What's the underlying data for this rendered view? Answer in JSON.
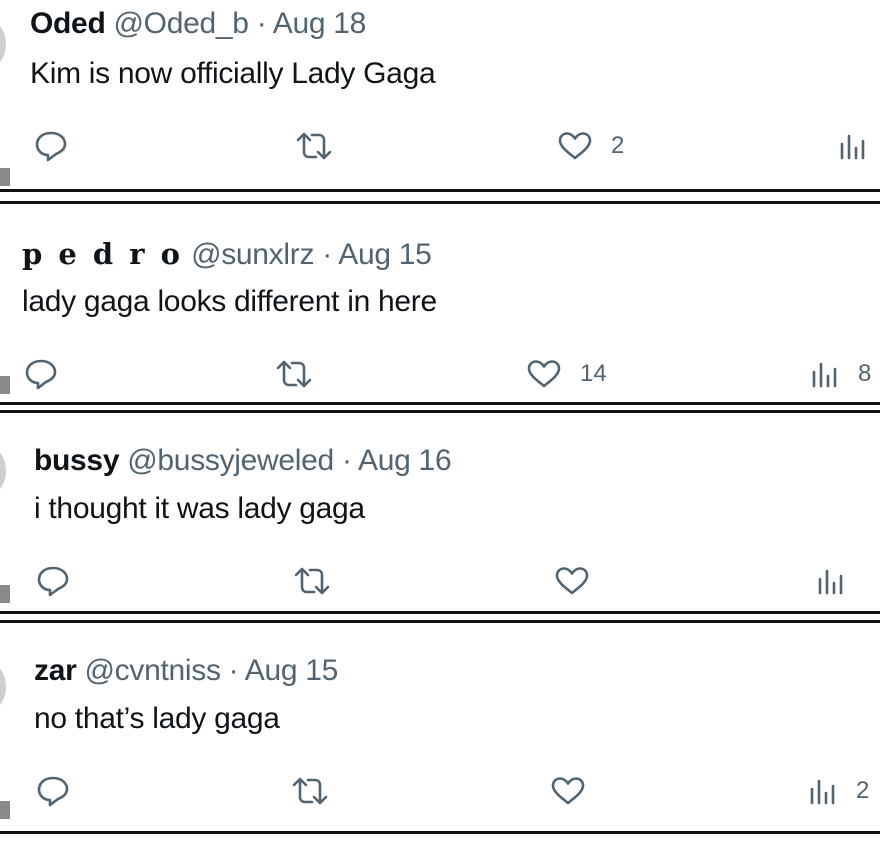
{
  "tweets": [
    {
      "name": "Oded",
      "handle": "@Oded_b",
      "date": "Aug 18",
      "text": "Kim is now officially Lady Gaga",
      "likes": "2",
      "views": ""
    },
    {
      "name": "p e d r o",
      "handle": "@sunxlrz",
      "date": "Aug 15",
      "text": "lady gaga looks different in here",
      "likes": "14",
      "views": "8"
    },
    {
      "name": "bussy",
      "handle": "@bussyjeweled",
      "date": "Aug 16",
      "text": "i thought it was lady gaga",
      "likes": "",
      "views": ""
    },
    {
      "name": "zar",
      "handle": "@cvntniss",
      "date": "Aug 15",
      "text": "no that’s lady gaga",
      "likes": "",
      "views": "2"
    }
  ],
  "separator": " · ",
  "icons": {
    "reply": "reply-icon",
    "retweet": "retweet-icon",
    "like": "heart-icon",
    "views": "views-icon"
  },
  "colors": {
    "text": "#0f1419",
    "muted": "#536471",
    "separator": "#111111"
  }
}
